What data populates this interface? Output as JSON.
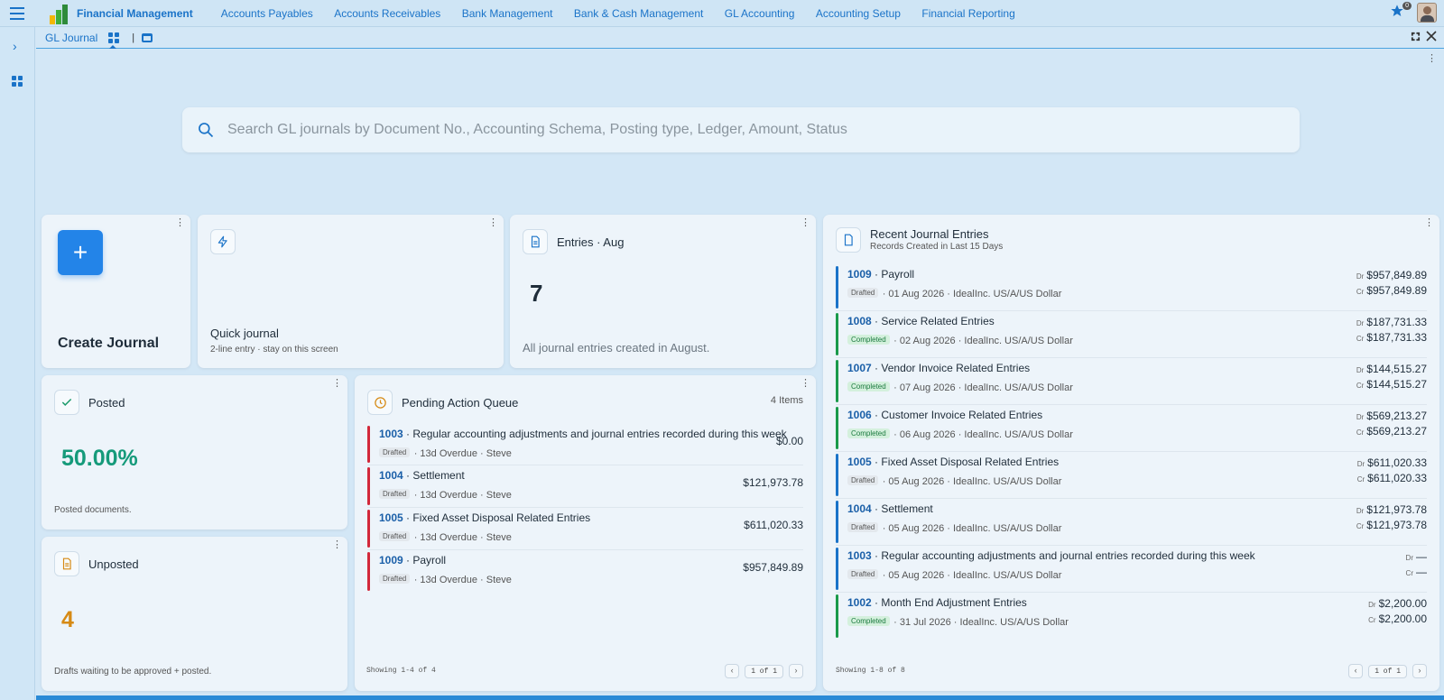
{
  "app": {
    "title": "Financial Management",
    "nav": [
      "Accounts Payables",
      "Accounts Receivables",
      "Bank Management",
      "Bank & Cash Management",
      "GL Accounting",
      "Accounting Setup",
      "Financial Reporting"
    ],
    "notif_count": "0"
  },
  "tab": {
    "title": "GL Journal",
    "separator": "|"
  },
  "search": {
    "placeholder": "Search GL journals by Document No., Accounting Schema, Posting type, Ledger, Amount, Status"
  },
  "create": {
    "label": "Create Journal",
    "plus": "+"
  },
  "quick": {
    "title": "Quick journal",
    "subtitle": "2-line entry · stay on this screen"
  },
  "entries": {
    "title": "Entries · Aug",
    "value": "7",
    "desc": "All journal entries created in August."
  },
  "posted": {
    "title": "Posted",
    "value": "50.00%",
    "desc": "Posted documents."
  },
  "unposted": {
    "title": "Unposted",
    "value": "4",
    "desc": "Drafts waiting to be approved + posted."
  },
  "pending": {
    "title": "Pending Action Queue",
    "count": "4 Items",
    "items": [
      {
        "no": "1003",
        "name": "· Regular accounting adjustments and journal entries recorded during this week",
        "status": "Drafted",
        "meta": "· 13d Overdue · Steve",
        "amount": "$0.00"
      },
      {
        "no": "1004",
        "name": "· Settlement",
        "status": "Drafted",
        "meta": "· 13d Overdue · Steve",
        "amount": "$121,973.78"
      },
      {
        "no": "1005",
        "name": "· Fixed Asset Disposal Related Entries",
        "status": "Drafted",
        "meta": "· 13d Overdue · Steve",
        "amount": "$611,020.33"
      },
      {
        "no": "1009",
        "name": "· Payroll",
        "status": "Drafted",
        "meta": "· 13d Overdue · Steve",
        "amount": "$957,849.89"
      }
    ],
    "showing": "Showing 1-4 of 4",
    "page": "1 of 1"
  },
  "recent": {
    "title": "Recent Journal Entries",
    "subtitle": "Records Created in Last 15 Days",
    "dr": "Dr",
    "cr": "Cr",
    "items": [
      {
        "no": "1009",
        "name": "· Payroll",
        "status": "Drafted",
        "meta": "· 01 Aug 2026 · IdealInc. US/A/US Dollar",
        "dr": "$957,849.89",
        "cr": "$957,849.89",
        "color": "#1a73c8"
      },
      {
        "no": "1008",
        "name": "· Service Related Entries",
        "status": "Completed",
        "meta": "· 02 Aug 2026 · IdealInc. US/A/US Dollar",
        "dr": "$187,731.33",
        "cr": "$187,731.33",
        "color": "#1a9a4a"
      },
      {
        "no": "1007",
        "name": "· Vendor Invoice Related Entries",
        "status": "Completed",
        "meta": "· 07 Aug 2026 · IdealInc. US/A/US Dollar",
        "dr": "$144,515.27",
        "cr": "$144,515.27",
        "color": "#1a9a4a"
      },
      {
        "no": "1006",
        "name": "· Customer Invoice Related Entries",
        "status": "Completed",
        "meta": "· 06 Aug 2026 · IdealInc. US/A/US Dollar",
        "dr": "$569,213.27",
        "cr": "$569,213.27",
        "color": "#1a9a4a"
      },
      {
        "no": "1005",
        "name": "· Fixed Asset Disposal Related Entries",
        "status": "Drafted",
        "meta": "· 05 Aug 2026 · IdealInc. US/A/US Dollar",
        "dr": "$611,020.33",
        "cr": "$611,020.33",
        "color": "#1a73c8"
      },
      {
        "no": "1004",
        "name": "· Settlement",
        "status": "Drafted",
        "meta": "· 05 Aug 2026 · IdealInc. US/A/US Dollar",
        "dr": "$121,973.78",
        "cr": "$121,973.78",
        "color": "#1a73c8"
      },
      {
        "no": "1003",
        "name": "· Regular accounting adjustments and journal entries recorded during this week",
        "status": "Drafted",
        "meta": "· 05 Aug 2026 · IdealInc. US/A/US Dollar",
        "dr": "—",
        "cr": "—",
        "color": "#1a73c8"
      },
      {
        "no": "1002",
        "name": "· Month End Adjustment Entries",
        "status": "Completed",
        "meta": "· 31 Jul 2026 · IdealInc. US/A/US Dollar",
        "dr": "$2,200.00",
        "cr": "$2,200.00",
        "color": "#1a9a4a"
      }
    ],
    "showing": "Showing 1-8 of 8",
    "page": "1 of 1"
  }
}
